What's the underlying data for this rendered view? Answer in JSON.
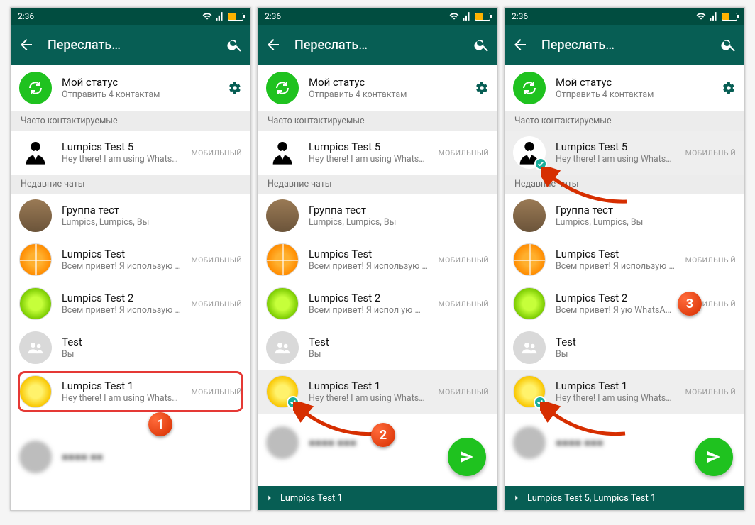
{
  "status_time": "2:36",
  "header_title": "Переслать…",
  "my_status": {
    "name": "Мой статус",
    "sub": "Отправить 4 контактам"
  },
  "sections": {
    "frequent": "Часто контактируемые",
    "recent": "Недавние чаты"
  },
  "type_label_mobile": "МОБИЛЬНЫЙ",
  "contacts": {
    "test5": {
      "name": "Lumpics Test 5",
      "sub": "Hey there! I am using WhatsApp."
    },
    "group": {
      "name": "Группа тест",
      "sub": "Lumpics, Lumpics, Вы"
    },
    "test": {
      "name": "Lumpics Test",
      "sub": "Всем привет! Я использую WhatsApp."
    },
    "test2": {
      "name": "Lumpics Test 2",
      "sub": "Всем привет! Я использую WhatsApp."
    },
    "testgrp": {
      "name": "Test",
      "sub": "Вы"
    },
    "test1": {
      "name": "Lumpics Test 1",
      "sub": "Hey there! I am using WhatsApp."
    }
  },
  "panel2_contacts_test2_sub": "Всем привет! Я испол        ую WhatsApp.",
  "panel3_contacts_test2_name": "Lumpics Test 2",
  "panel3_contacts_test2_sub": "Всем привет! Я           ую WhatsApp.",
  "bottombar": {
    "panel2": "Lumpics Test 1",
    "panel3": "Lumpics Test 5, Lumpics Test 1"
  },
  "step_labels": {
    "1": "1",
    "2": "2",
    "3": "3"
  }
}
